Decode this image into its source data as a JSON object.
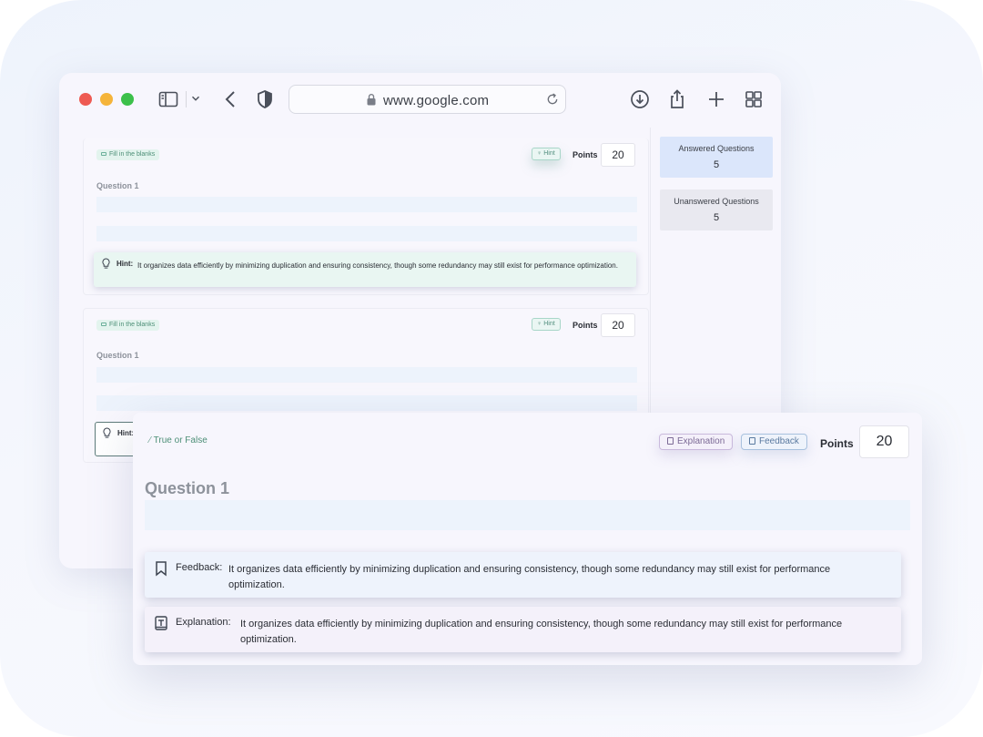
{
  "browser": {
    "url": "www.google.com"
  },
  "questions": [
    {
      "type_label": "Fill in the blanks",
      "hint_button": "Hint",
      "points_label": "Points",
      "points_value": "20",
      "title": "Question 1",
      "hint_label": "Hint:",
      "hint_text": "It organizes data efficiently by minimizing duplication and ensuring consistency, though some redundancy may still exist for performance optimization."
    },
    {
      "type_label": "Fill in the blanks",
      "hint_button": "Hint",
      "points_label": "Points",
      "points_value": "20",
      "title": "Question 1",
      "hint_label": "Hint:"
    }
  ],
  "stats": {
    "answered_label": "Answered Questions",
    "answered_value": "5",
    "unanswered_label": "Unanswered Questions",
    "unanswered_value": "5"
  },
  "front_card": {
    "type_label": "True or False",
    "explanation_button": "Explanation",
    "feedback_button": "Feedback",
    "points_label": "Points",
    "points_value": "20",
    "title": "Question 1",
    "feedback_label": "Feedback:",
    "feedback_text": "It organizes data efficiently by minimizing duplication and ensuring consistency, though some redundancy may still exist for performance optimization.",
    "explanation_label": "Explanation:",
    "explanation_text": "It organizes data efficiently by minimizing duplication and ensuring consistency, though some redundancy may still exist for performance optimization."
  },
  "icons": {
    "sidebar": "sidebar-icon",
    "chevron": "chevron-down-icon",
    "back": "back-icon",
    "shield": "shield-icon",
    "lock": "lock-icon",
    "reload": "reload-icon",
    "download": "download-icon",
    "share": "share-icon",
    "new_tab": "plus-icon",
    "tabs": "grid-icon",
    "hint": "lightbulb-icon",
    "feedback": "bookmark-icon",
    "explanation": "text-box-icon"
  }
}
